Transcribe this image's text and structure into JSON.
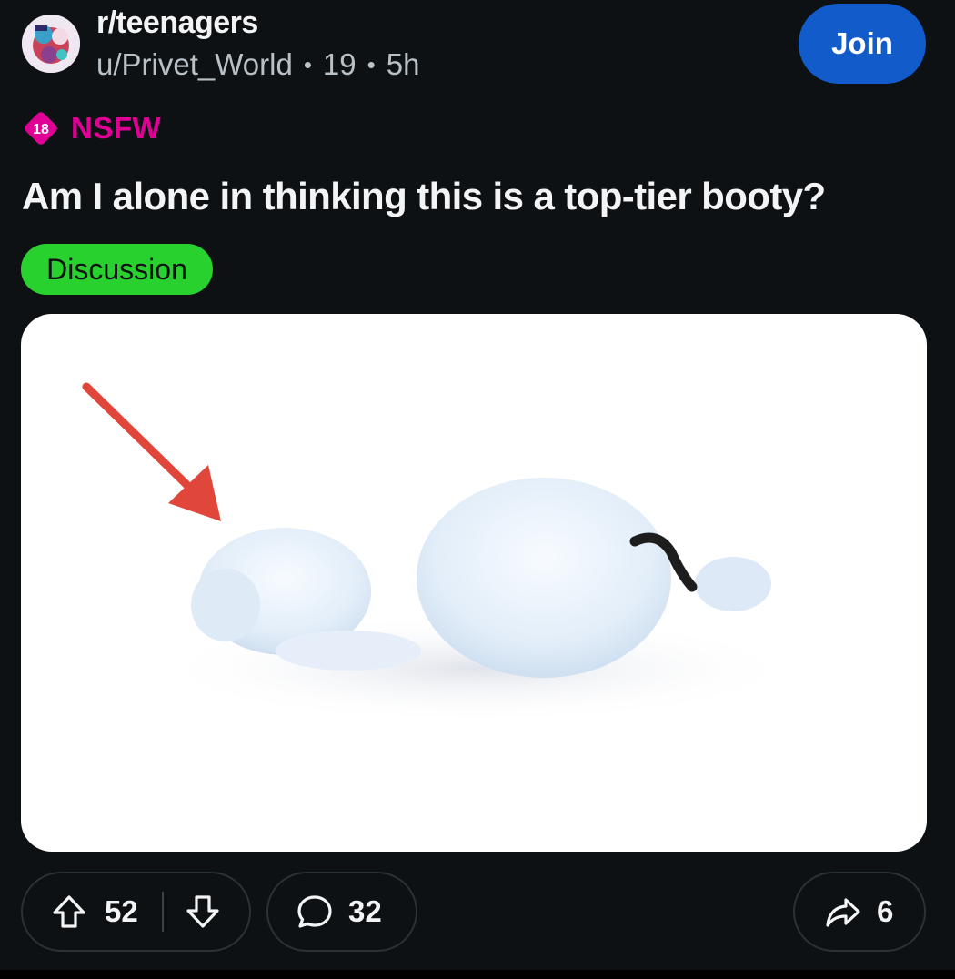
{
  "post": {
    "subreddit": "r/teenagers",
    "author": "u/Privet_World",
    "author_age": "19",
    "time_ago": "5h",
    "separator": "•",
    "join_label": "Join",
    "nsfw": {
      "badge_text": "18",
      "label": "NSFW",
      "color": "#e00096"
    },
    "title": "Am I alone in thinking this is a top-tier booty?",
    "flair": {
      "label": "Discussion",
      "color": "#28d12e"
    },
    "image": {
      "description_icon": "snowman-lying-down-illustration",
      "arrow_color": "#e0473a"
    }
  },
  "actions": {
    "upvote_icon": "arrow-up-outline-icon",
    "score": "52",
    "downvote_icon": "arrow-down-outline-icon",
    "comment_icon": "speech-bubble-icon",
    "comments": "32",
    "share_icon": "share-arrow-icon",
    "shares": "6"
  },
  "colors": {
    "background": "#0e1113",
    "join_button": "#115bca",
    "text_primary": "#f2f4f5",
    "text_secondary": "#b7c1c7"
  }
}
